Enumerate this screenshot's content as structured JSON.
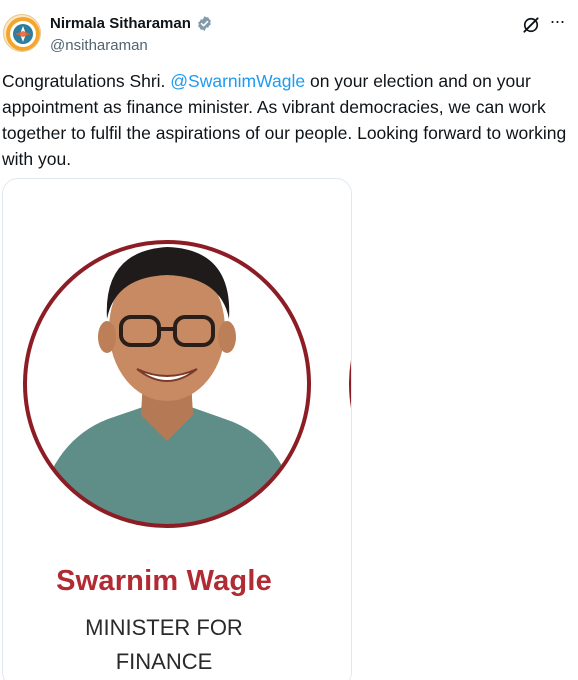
{
  "author": {
    "name": "Nirmala Sitharaman",
    "handle": "@nsitharaman"
  },
  "tweet": {
    "text_before_mention": "Congratulations Shri. ",
    "mention": "@SwarnimWagle",
    "text_after_mention": " on your election and on your appointment as finance minister.  As vibrant democracies, we can work together to fulfil the aspirations of our people. Looking forward to working with you."
  },
  "media": {
    "poster_name": "Swarnim Wagle",
    "poster_title_line1": "MINISTER FOR",
    "poster_title_line2": "FINANCE"
  },
  "icons": {
    "verified": "verified-badge-icon",
    "grok": "grok-icon",
    "more": "more-options-icon"
  },
  "colors": {
    "mention": "#1d9bf0",
    "poster_name": "#b02b33",
    "circle_border": "#8c1d25",
    "verified_badge": "#829aab"
  }
}
